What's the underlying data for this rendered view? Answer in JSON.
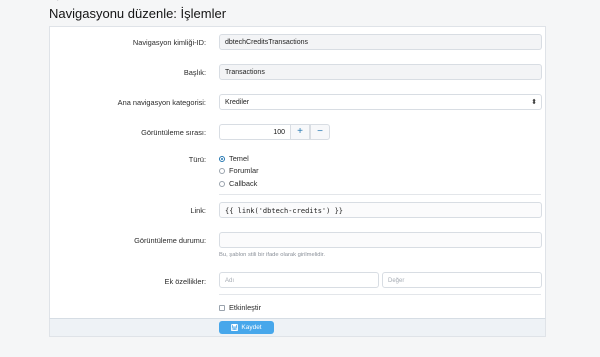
{
  "page": {
    "title": "Navigasyonu düzenle: İşlemler",
    "breadcrumb_partial": "···  ›  ··········"
  },
  "form": {
    "nav_id": {
      "label": "Navigasyon kimliği-ID:",
      "value": "dbtechCreditsTransactions"
    },
    "title": {
      "label": "Başlık:",
      "value": "Transactions"
    },
    "parent": {
      "label": "Ana navigasyon kategorisi:",
      "value": "Krediler"
    },
    "display_order": {
      "label": "Görüntüleme sırası:",
      "value": "100",
      "plus": "+",
      "minus": "−"
    },
    "type": {
      "label": "Türü:",
      "options": [
        "Temel",
        "Forumlar",
        "Callback"
      ],
      "selected": "Temel"
    },
    "link": {
      "label": "Link:",
      "value": "{{ link('dbtech-credits') }}"
    },
    "display_condition": {
      "label": "Görüntüleme durumu:",
      "value": "",
      "hint": "Bu, şablon stili bir ifade olarak girilmelidir."
    },
    "extra_attrs": {
      "label": "Ek özellikler:",
      "name_placeholder": "Adı",
      "value_placeholder": "Değer"
    },
    "enable": {
      "label": "Etkinleştir",
      "checked": false
    }
  },
  "footer": {
    "save_label": "Kaydet"
  },
  "colors": {
    "accent": "#2577b1",
    "button": "#47a7eb"
  }
}
